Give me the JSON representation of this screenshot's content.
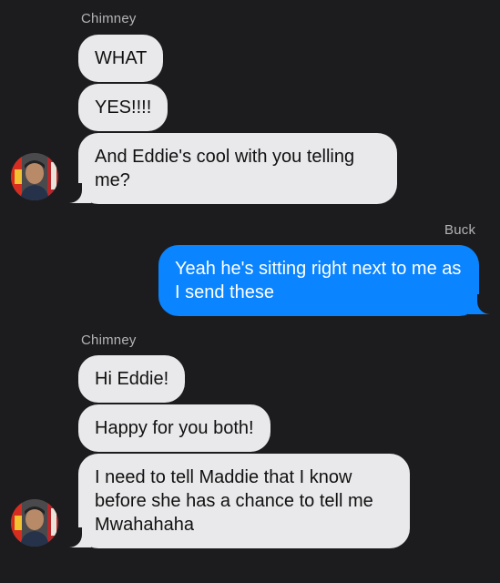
{
  "thread": {
    "messages": [
      {
        "sender": "Chimney",
        "direction": "incoming",
        "text": "WHAT"
      },
      {
        "sender": "Chimney",
        "direction": "incoming",
        "text": "YES!!!!"
      },
      {
        "sender": "Chimney",
        "direction": "incoming",
        "text": "And Eddie's cool with you telling me?"
      },
      {
        "sender": "Buck",
        "direction": "outgoing",
        "text": "Yeah he's sitting right next to me as I send these"
      },
      {
        "sender": "Chimney",
        "direction": "incoming",
        "text": "Hi Eddie!"
      },
      {
        "sender": "Chimney",
        "direction": "incoming",
        "text": "Happy for you both!"
      },
      {
        "sender": "Chimney",
        "direction": "incoming",
        "text": "I need to tell Maddie that I know before she has a chance to tell me Mwahahaha"
      }
    ],
    "sender_labels": [
      "Chimney",
      "Buck",
      "Chimney"
    ]
  },
  "colors": {
    "background": "#1c1c1e",
    "incoming_bubble": "#e9e9eb",
    "outgoing_bubble": "#0a84ff",
    "sender_label": "#b4b4b8"
  },
  "icons": {
    "avatar": "contact-photo-avatar"
  }
}
